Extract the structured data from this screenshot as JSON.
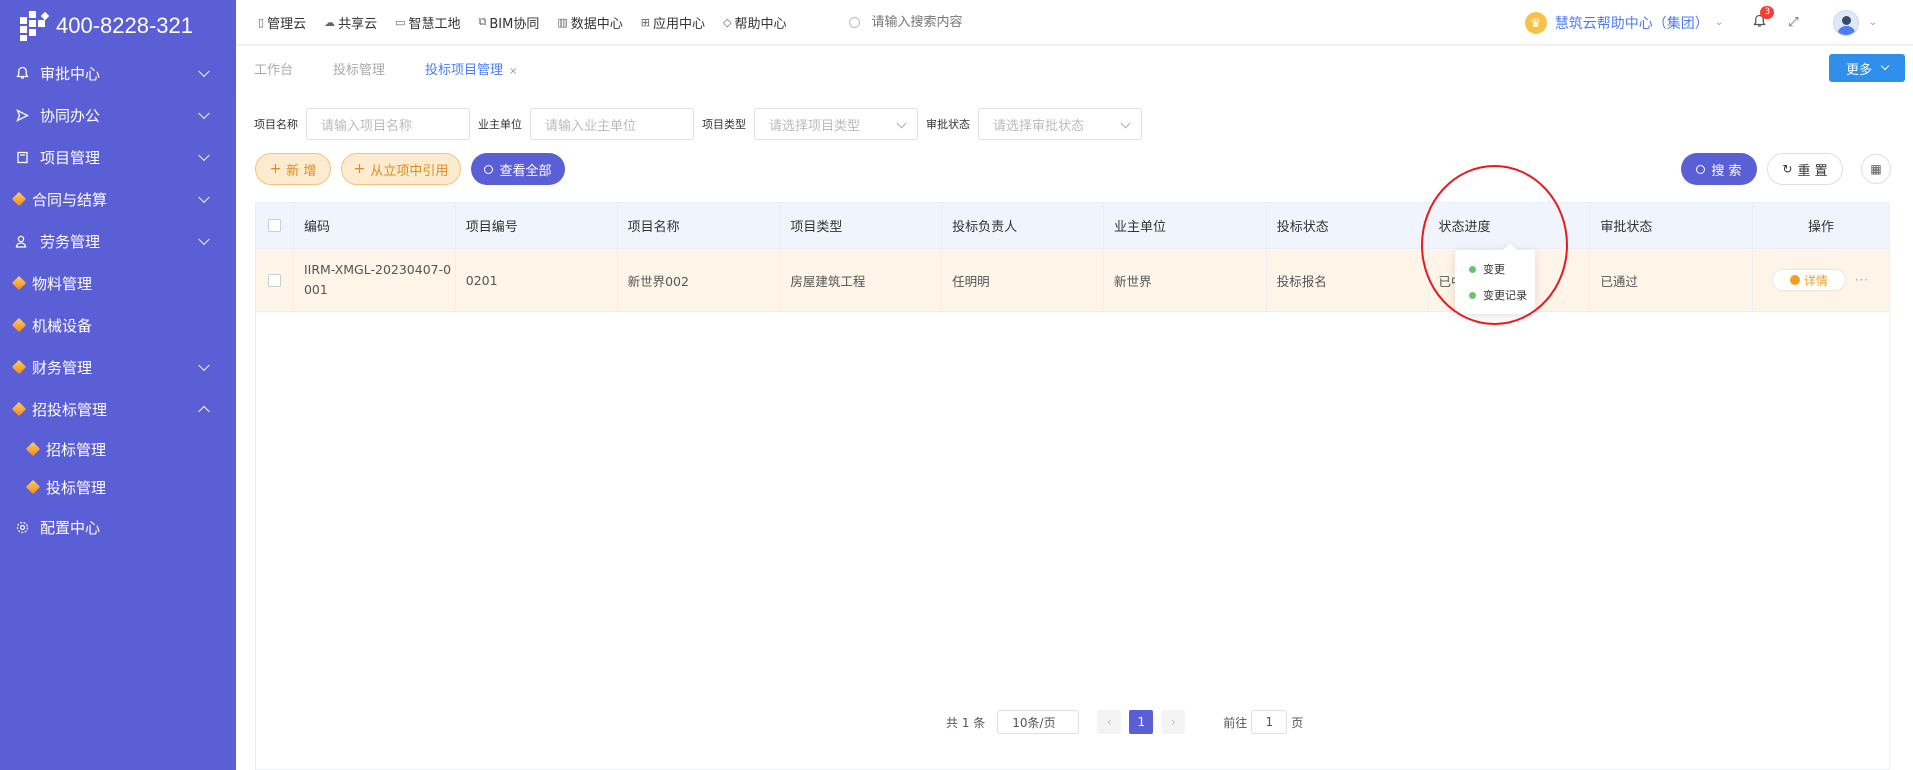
{
  "logo": {
    "phone": "400-8228-321"
  },
  "sidebar": {
    "items": [
      {
        "label": "审批中心",
        "icon": "bell-icon"
      },
      {
        "label": "协同办公",
        "icon": "send-icon"
      },
      {
        "label": "项目管理",
        "icon": "book-icon"
      },
      {
        "label": "合同与结算",
        "icon": "gem-icon"
      },
      {
        "label": "劳务管理",
        "icon": "user-icon"
      },
      {
        "label": "物料管理",
        "icon": "gem-icon"
      },
      {
        "label": "机械设备",
        "icon": "gem-icon"
      },
      {
        "label": "财务管理",
        "icon": "gem-icon"
      },
      {
        "label": "招投标管理",
        "icon": "gem-icon"
      }
    ],
    "sub_items": [
      {
        "label": "招标管理"
      },
      {
        "label": "投标管理"
      }
    ],
    "config": {
      "label": "配置中心",
      "icon": "gear-icon"
    }
  },
  "topnav": {
    "items": [
      {
        "label": "管理云"
      },
      {
        "label": "共享云"
      },
      {
        "label": "智慧工地"
      },
      {
        "label": "BIM协同"
      },
      {
        "label": "数据中心"
      },
      {
        "label": "应用中心"
      },
      {
        "label": "帮助中心"
      }
    ],
    "search_placeholder": "请输入搜索内容",
    "help_center": "慧筑云帮助中心（集团）",
    "notification_count": "3"
  },
  "tabs": {
    "items": [
      {
        "label": "工作台"
      },
      {
        "label": "投标管理"
      },
      {
        "label": "投标项目管理"
      }
    ],
    "close": "×",
    "more": "更多"
  },
  "filters": {
    "project_name": {
      "label": "项目名称",
      "placeholder": "请输入项目名称"
    },
    "owner_unit": {
      "label": "业主单位",
      "placeholder": "请输入业主单位"
    },
    "project_type": {
      "label": "项目类型",
      "placeholder": "请选择项目类型"
    },
    "approval_status": {
      "label": "审批状态",
      "placeholder": "请选择审批状态"
    }
  },
  "actions": {
    "add": "新 增",
    "import": "从立项中引用",
    "view_all": "查看全部",
    "search": "搜 索",
    "reset": "重 置"
  },
  "table": {
    "headers": [
      "编码",
      "项目编号",
      "项目名称",
      "项目类型",
      "投标负责人",
      "业主单位",
      "投标状态",
      "状态进度",
      "审批状态",
      "操作"
    ],
    "rows": [
      {
        "code_line1": "IIRM-XMGL-20230407-0",
        "code_line2": "001",
        "number": "0201",
        "name": "新世界002",
        "type": "房屋建筑工程",
        "manager": "任明明",
        "owner": "新世界",
        "bid_status": "投标报名",
        "progress": "已中标",
        "approval": "已通过",
        "detail": "详情"
      }
    ]
  },
  "dropdown": {
    "items": [
      {
        "label": "变更"
      },
      {
        "label": "变更记录"
      }
    ]
  },
  "pager": {
    "total": "共 1 条",
    "size": "10条/页",
    "current": "1",
    "goto_label": "前往",
    "goto_value": "1",
    "page_unit": "页"
  },
  "colors": {
    "sidebar": "#5b5fd6",
    "accent": "#4d7cf5",
    "highlight_row": "#fef4e8",
    "annotation": "#e8191f"
  }
}
